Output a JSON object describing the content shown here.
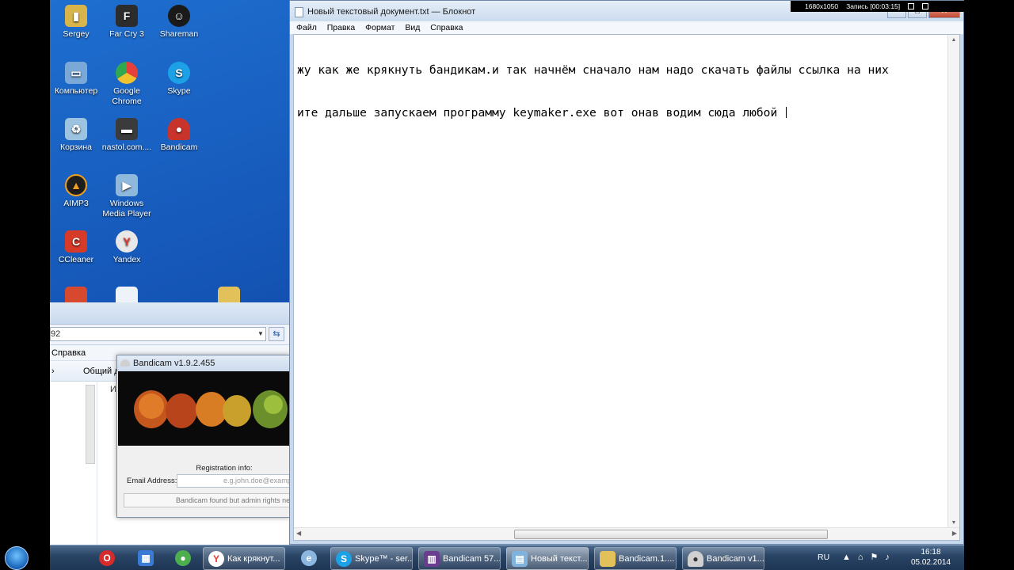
{
  "desktop_icons": [
    {
      "label": "Sergey",
      "icon": "user-folder-icon",
      "color": "#d8b44a"
    },
    {
      "label": "Far Cry 3",
      "icon": "farcry-icon",
      "color": "#2c2c2c"
    },
    {
      "label": "Shareman",
      "icon": "shareman-icon",
      "color": "#1a1a1a"
    },
    {
      "label": "Компьютер",
      "icon": "computer-icon",
      "color": "#7aa9d8"
    },
    {
      "label": "Google Chrome",
      "icon": "chrome-icon",
      "color": "#e5413a"
    },
    {
      "label": "Skype",
      "icon": "skype-icon",
      "color": "#1da1e6"
    },
    {
      "label": "Корзина",
      "icon": "recycle-bin-icon",
      "color": "#9cc4e0"
    },
    {
      "label": "nastol.com....",
      "icon": "nastol-icon",
      "color": "#3b3b3b"
    },
    {
      "label": "Bandicam",
      "icon": "bandicam-icon",
      "color": "#c8342c"
    },
    {
      "label": "AIMP3",
      "icon": "aimp-icon",
      "color": "#f0a020"
    },
    {
      "label": "Windows Media Player",
      "icon": "media-player-icon",
      "color": "#8fb8dd"
    },
    {
      "label": "CCleaner",
      "icon": "ccleaner-icon",
      "color": "#d63b2a"
    },
    {
      "label": "Yandex",
      "icon": "yandex-icon",
      "color": "#e8e8e8"
    }
  ],
  "explorer": {
    "address": "92",
    "menu": "Справка",
    "toolbar_item": "Общий д",
    "pane_item": "И"
  },
  "bandicam_dialog": {
    "title": "Bandicam v1.9.2.455",
    "registration_label": "Registration info:",
    "email_label": "Email Address:",
    "email_placeholder": "e.g.john.doe@examp",
    "status": "Bandicam found but admin rights ne"
  },
  "notepad": {
    "title": "Новый текстовый документ.txt — Блокнот",
    "menu": [
      "Файл",
      "Правка",
      "Формат",
      "Вид",
      "Справка"
    ],
    "lines": [
      "жу как же крякнуть бандикам.и так начнём сначало нам надо скачать файлы ссылка на них",
      "ите дальше запускаем программу keymaker.exe вот онав водим сюда любой "
    ]
  },
  "recording": {
    "resolution": "1680x1050",
    "status": "Запись [00:03:15]"
  },
  "taskbar": {
    "items": [
      {
        "label": "Как крякнут...",
        "icon": "yandex-browser-icon",
        "color": "#e23a2e"
      },
      {
        "label": "Skype™ - ser...",
        "icon": "skype-icon",
        "color": "#1da1e6"
      },
      {
        "label": "Bandicam 57...",
        "icon": "winrar-icon",
        "color": "#6a3d8f"
      },
      {
        "label": "Новый текст...",
        "icon": "notepad-icon",
        "color": "#7fb3dd"
      },
      {
        "label": "Bandicam.1....",
        "icon": "folder-icon",
        "color": "#e2c15a"
      },
      {
        "label": "Bandicam v1...",
        "icon": "bandicam-icon",
        "color": "#d0d0d0"
      }
    ],
    "language": "RU",
    "time": "16:18",
    "date": "05.02.2014"
  }
}
